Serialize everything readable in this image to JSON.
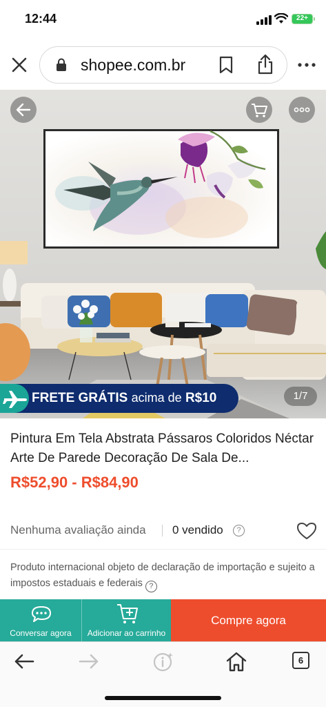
{
  "status_bar": {
    "time": "12:44",
    "battery": "22+"
  },
  "browser": {
    "url": "shopee.com.br"
  },
  "product_image": {
    "counter": "1/7"
  },
  "promo": {
    "main": "FRETE GRÁTIS",
    "sub": "acima de",
    "value": "R$10"
  },
  "product": {
    "title": "Pintura Em Tela Abstrata Pássaros Coloridos Néctar Arte De Parede Decoração De Sala De...",
    "price": "R$52,90 - R$84,90",
    "rating_text": "Nenhuma avaliação ainda",
    "sold_text": "0 vendido",
    "notice": "Produto internacional objeto de declaração de importação e sujeito a impostos estaduais e federais"
  },
  "actions": {
    "chat_label": "Conversar agora",
    "cart_label": "Adicionar ao carrinho",
    "buy_label": "Compre agora"
  },
  "toolbar": {
    "tabs_count": "6"
  },
  "colors": {
    "shopee_orange": "#ee4d2d",
    "shopee_teal": "#26aa99",
    "promo_navy": "#0e2c6e"
  }
}
